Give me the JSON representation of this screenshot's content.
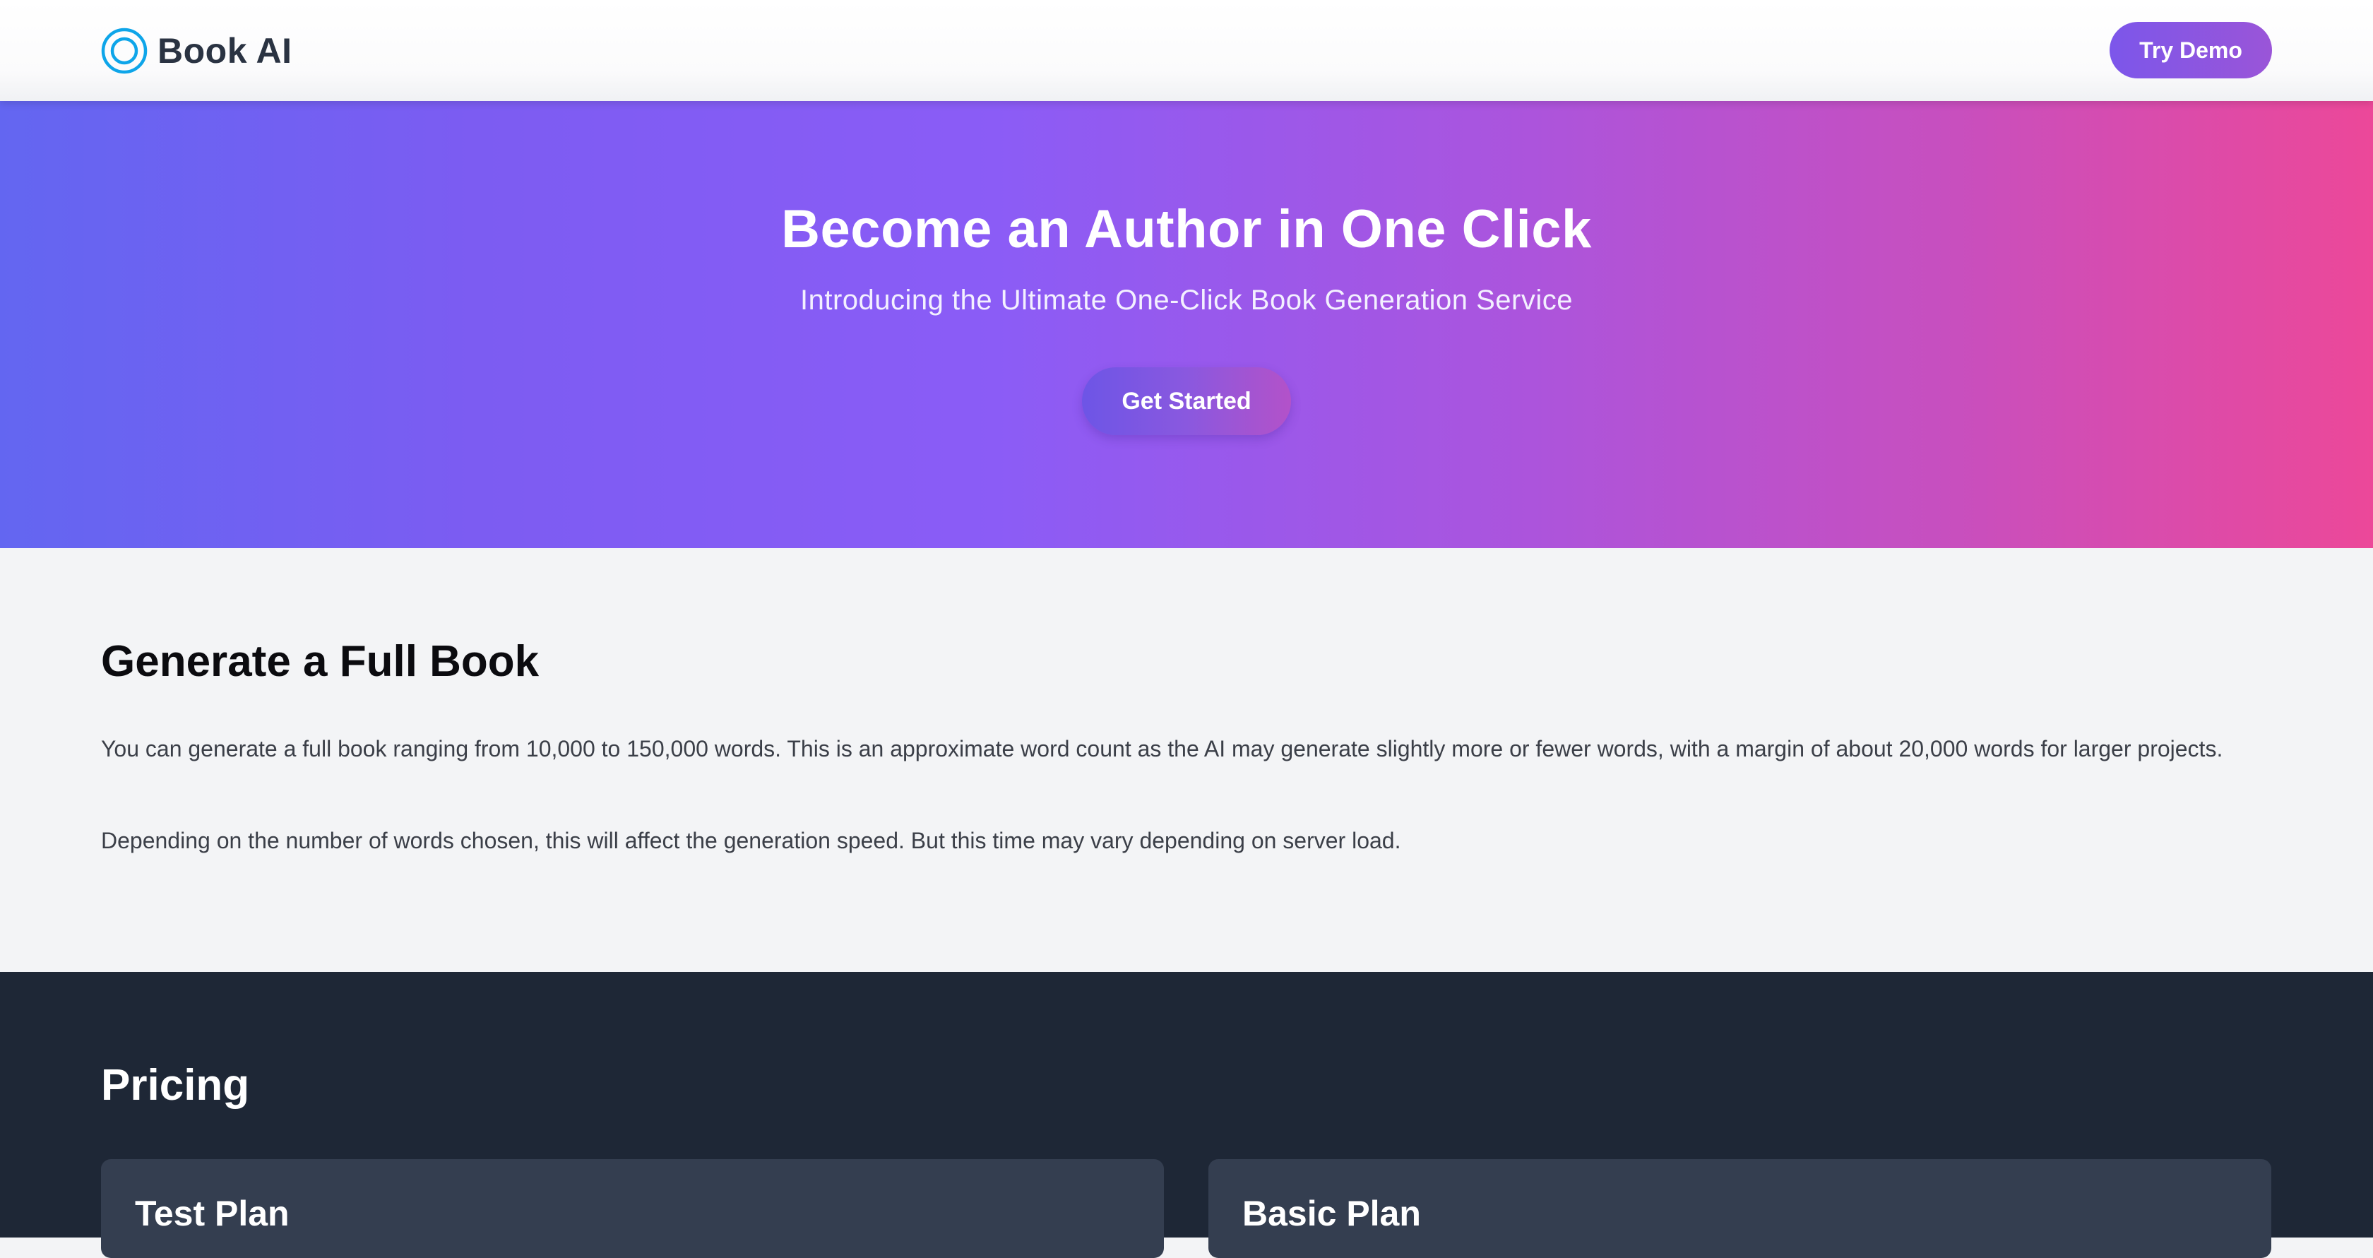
{
  "header": {
    "brand_name": "Book AI",
    "try_demo_label": "Try Demo"
  },
  "hero": {
    "title": "Become an Author in One Click",
    "subtitle": "Introducing the Ultimate One-Click Book Generation Service",
    "cta_label": "Get Started"
  },
  "features": {
    "title": "Generate a Full Book",
    "paragraph_1": "You can generate a full book ranging from 10,000 to 150,000 words. This is an approximate word count as the AI may generate slightly more or fewer words, with a margin of about 20,000 words for larger projects.",
    "paragraph_2": "Depending on the number of words chosen, this will affect the generation speed. But this time may vary depending on server load."
  },
  "pricing": {
    "title": "Pricing",
    "plans": [
      {
        "name": "Test Plan"
      },
      {
        "name": "Basic Plan"
      }
    ]
  },
  "colors": {
    "brand_icon": "#0ea5e9",
    "hero_gradient_start": "#6366f1",
    "hero_gradient_end": "#ec4899",
    "pricing_bg": "#1e2736",
    "plan_card_bg": "#343e50"
  },
  "icons": {
    "brand": "ring-logo-icon"
  }
}
